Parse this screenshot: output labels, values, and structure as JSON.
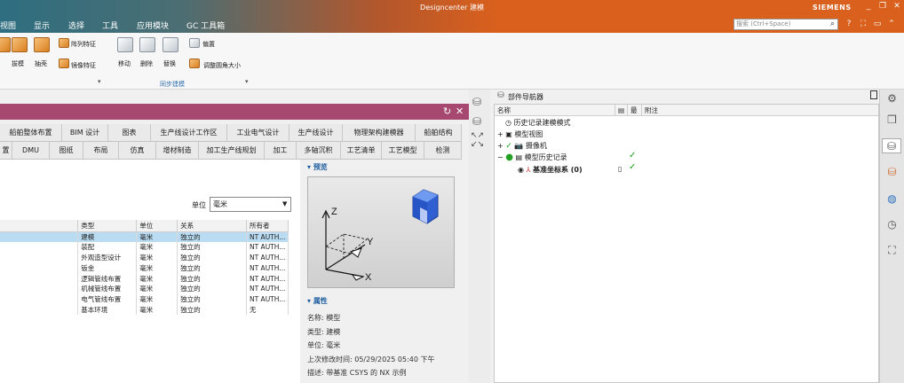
{
  "app": {
    "title": "Designcenter 建模",
    "brand": "SIEMENS"
  },
  "menu": [
    "视图",
    "显示",
    "选择",
    "工具",
    "应用模块",
    "GC 工具箱"
  ],
  "search": {
    "placeholder": "搜索 (Ctrl+Space)"
  },
  "ribbon": {
    "buttons": [
      "拔模",
      "抽壳",
      "移动",
      "删除",
      "替换"
    ],
    "small_buttons": [
      "阵列特征",
      "镜像特征",
      "偏置",
      "调整圆角大小"
    ],
    "group_label": "同步建模"
  },
  "dialog": {
    "tabs_row1": [
      "船舶整体布置",
      "BIM 设计",
      "图表",
      "生产线设计工作区",
      "工业电气设计",
      "生产线设计",
      "物理架构建模器",
      "船舶结构"
    ],
    "tabs_row2": [
      "置",
      "DMU",
      "图纸",
      "布局",
      "仿真",
      "增材制造",
      "加工生产线规划",
      "加工",
      "多轴沉积",
      "工艺清单",
      "工艺模型",
      "检测"
    ],
    "unit_label": "单位",
    "unit_value": "毫米",
    "table": {
      "headers": [
        "类型",
        "单位",
        "关系",
        "所有者"
      ],
      "rows": [
        [
          "建模",
          "毫米",
          "独立的",
          "NT AUTH..."
        ],
        [
          "装配",
          "毫米",
          "独立的",
          "NT AUTH..."
        ],
        [
          "外观造型设计",
          "毫米",
          "独立的",
          "NT AUTH..."
        ],
        [
          "钣金",
          "毫米",
          "独立的",
          "NT AUTH..."
        ],
        [
          "逻辑管线布置",
          "毫米",
          "独立的",
          "NT AUTH..."
        ],
        [
          "机械管线布置",
          "毫米",
          "独立的",
          "NT AUTH..."
        ],
        [
          "电气管线布置",
          "毫米",
          "独立的",
          "NT AUTH..."
        ],
        [
          "基本环境",
          "毫米",
          "独立的",
          "无"
        ]
      ],
      "selected_row": 0
    },
    "preview": {
      "section_label": "预览",
      "axis_x": "X",
      "axis_y": "Y",
      "axis_z": "Z"
    },
    "properties": {
      "section_label": "属性",
      "name": "名称: 模型",
      "type": "类型: 建模",
      "unit": "单位: 毫米",
      "modified": "上次修改时间: 05/29/2025 05:40 下午",
      "description": "描述: 带基准 CSYS 的 NX 示例"
    }
  },
  "navigator": {
    "title": "部件导航器",
    "columns": [
      "名称",
      "",
      "最",
      "附注"
    ],
    "nodes": [
      "历史记录建模模式",
      "模型视图",
      "摄像机",
      "模型历史记录",
      "基准坐标系 (0)"
    ]
  },
  "colors": {
    "dialog_title": "#a6486f",
    "accent": "#d9601d",
    "selected_row": "#b9dcf2"
  }
}
